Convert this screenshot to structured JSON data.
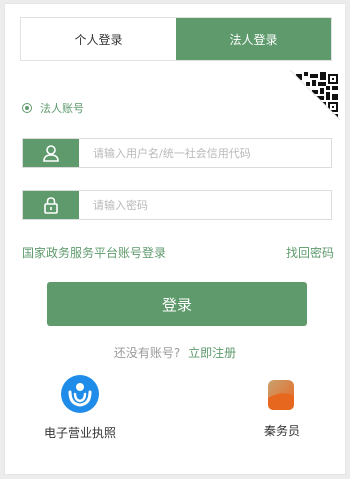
{
  "tabs": [
    {
      "label": "个人登录",
      "active": false
    },
    {
      "label": "法人登录",
      "active": true
    }
  ],
  "account_type": {
    "label": "法人账号",
    "selected": true
  },
  "username": {
    "placeholder": "请输入用户名/统一社会信用代码",
    "icon": "user-icon"
  },
  "password": {
    "placeholder": "请输入密码",
    "icon": "lock-icon"
  },
  "links": {
    "gov_platform": "国家政务服务平台账号登录",
    "forgot_password": "找回密码"
  },
  "login_button": "登录",
  "register": {
    "question": "还没有账号?",
    "link": "立即注册"
  },
  "apps": [
    {
      "label": "电子营业执照",
      "icon": "electronic-license-icon"
    },
    {
      "label": "秦务员",
      "icon": "qinwuyuan-app-icon"
    }
  ],
  "colors": {
    "accent": "#5e9a6c",
    "license_blue": "#1e8ce8",
    "app_orange": "#e8671f"
  }
}
